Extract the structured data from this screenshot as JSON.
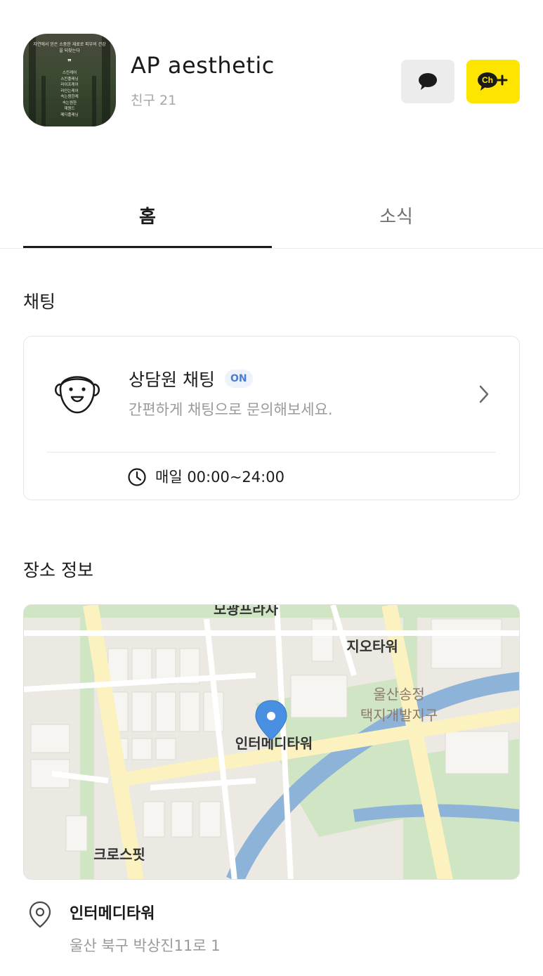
{
  "profile": {
    "name": "AP aesthetic",
    "friends": "친구 21",
    "avatar_quote": "자연에서 얻은 소중한 재료로 피부의 건강을 되찾는다",
    "avatar_items": [
      "스킨케어",
      "스킨플래닝",
      "라이프케어",
      "라인는케어",
      "속는원한케",
      "속는원한",
      "재원드",
      "메디플래닝"
    ]
  },
  "actions": {
    "chat_icon": "chat-bubble-icon",
    "add_channel_icon": "channel-add-icon",
    "add_channel_label": "Ch"
  },
  "tabs": [
    {
      "label": "홈",
      "active": true
    },
    {
      "label": "소식",
      "active": false
    }
  ],
  "chat_section": {
    "title": "채팅",
    "card": {
      "title": "상담원 채팅",
      "badge": "ON",
      "description": "간편하게 채팅으로 문의해보세요.",
      "hours": "매일 00:00~24:00"
    }
  },
  "location_section": {
    "title": "장소 정보",
    "map_labels": {
      "top": "모광프라자",
      "geo_tower": "지오타워",
      "district_line1": "울산송정",
      "district_line2": "택지개발지구",
      "inter_medi": "인터메디타워",
      "crossfit": "크로스핏"
    },
    "place_name": "인터메디타워",
    "address": "울산 북구 박상진11로 1"
  },
  "colors": {
    "kakao_yellow": "#fee500",
    "badge_blue": "#4a7fd4",
    "pin_blue": "#4a90e2"
  }
}
